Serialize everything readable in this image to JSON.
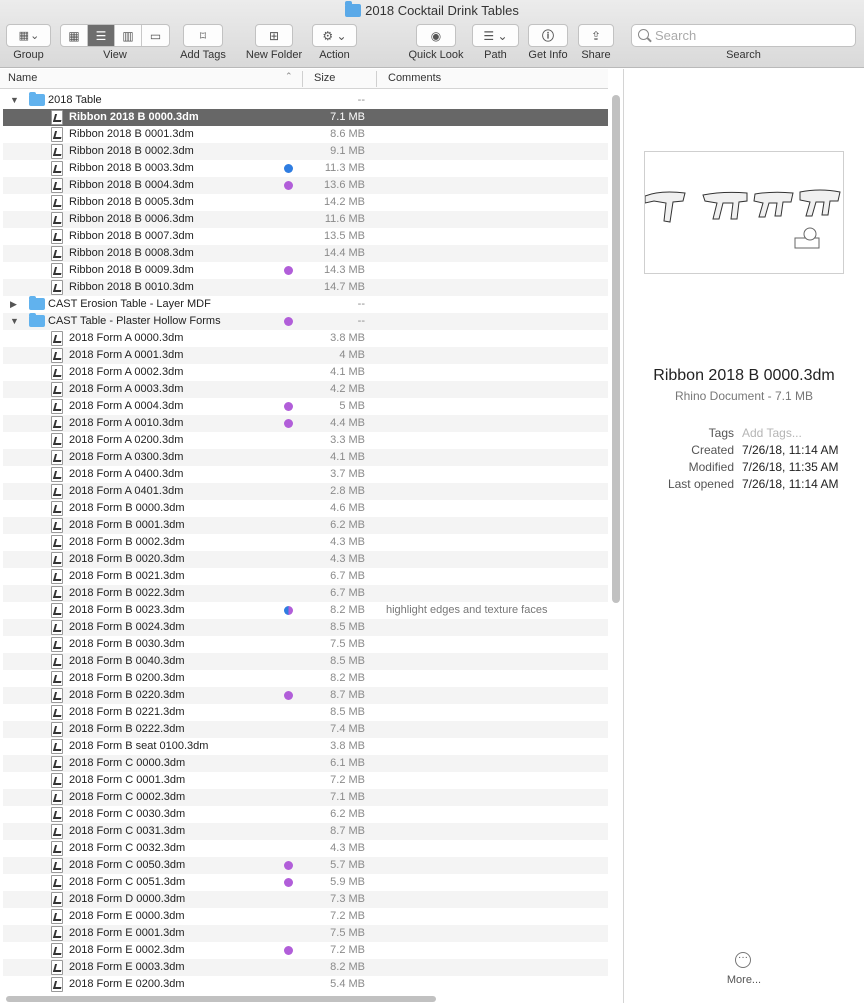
{
  "window": {
    "title": "2018 Cocktail Drink Tables"
  },
  "toolbar": {
    "group_label": "Group",
    "view_label": "View",
    "add_tags_label": "Add Tags",
    "new_folder_label": "New Folder",
    "action_label": "Action",
    "quick_look_label": "Quick Look",
    "path_label": "Path",
    "get_info_label": "Get Info",
    "share_label": "Share",
    "search_label": "Search",
    "search_placeholder": "Search"
  },
  "columns": {
    "name": "Name",
    "size": "Size",
    "comments": "Comments"
  },
  "rows": [
    {
      "type": "folder",
      "level": 0,
      "expanded": true,
      "name": "2018 Table",
      "size": "--"
    },
    {
      "type": "file",
      "level": 1,
      "name": "Ribbon 2018 B 0000.3dm",
      "size": "7.1 MB",
      "selected": true
    },
    {
      "type": "file",
      "level": 1,
      "name": "Ribbon 2018 B 0001.3dm",
      "size": "8.6 MB"
    },
    {
      "type": "file",
      "level": 1,
      "name": "Ribbon 2018 B 0002.3dm",
      "size": "9.1 MB"
    },
    {
      "type": "file",
      "level": 1,
      "name": "Ribbon 2018 B 0003.3dm",
      "size": "11.3 MB",
      "tag": "blue"
    },
    {
      "type": "file",
      "level": 1,
      "name": "Ribbon 2018 B 0004.3dm",
      "size": "13.6 MB",
      "tag": "purple"
    },
    {
      "type": "file",
      "level": 1,
      "name": "Ribbon 2018 B 0005.3dm",
      "size": "14.2 MB"
    },
    {
      "type": "file",
      "level": 1,
      "name": "Ribbon 2018 B 0006.3dm",
      "size": "11.6 MB"
    },
    {
      "type": "file",
      "level": 1,
      "name": "Ribbon 2018 B 0007.3dm",
      "size": "13.5 MB"
    },
    {
      "type": "file",
      "level": 1,
      "name": "Ribbon 2018 B 0008.3dm",
      "size": "14.4 MB"
    },
    {
      "type": "file",
      "level": 1,
      "name": "Ribbon 2018 B 0009.3dm",
      "size": "14.3 MB",
      "tag": "purple"
    },
    {
      "type": "file",
      "level": 1,
      "name": "Ribbon 2018 B 0010.3dm",
      "size": "14.7 MB"
    },
    {
      "type": "folder",
      "level": 0,
      "expanded": false,
      "name": "CAST Erosion Table - Layer MDF",
      "size": "--"
    },
    {
      "type": "folder",
      "level": 0,
      "expanded": true,
      "name": "CAST Table - Plaster Hollow Forms",
      "size": "--",
      "tag": "purple"
    },
    {
      "type": "file",
      "level": 1,
      "name": "2018 Form A 0000.3dm",
      "size": "3.8 MB"
    },
    {
      "type": "file",
      "level": 1,
      "name": "2018 Form A 0001.3dm",
      "size": "4 MB"
    },
    {
      "type": "file",
      "level": 1,
      "name": "2018 Form A 0002.3dm",
      "size": "4.1 MB"
    },
    {
      "type": "file",
      "level": 1,
      "name": "2018 Form A 0003.3dm",
      "size": "4.2 MB"
    },
    {
      "type": "file",
      "level": 1,
      "name": "2018 Form A 0004.3dm",
      "size": "5 MB",
      "tag": "purple"
    },
    {
      "type": "file",
      "level": 1,
      "name": "2018 Form A 0010.3dm",
      "size": "4.4 MB",
      "tag": "purple"
    },
    {
      "type": "file",
      "level": 1,
      "name": "2018 Form A 0200.3dm",
      "size": "3.3 MB"
    },
    {
      "type": "file",
      "level": 1,
      "name": "2018 Form A 0300.3dm",
      "size": "4.1 MB"
    },
    {
      "type": "file",
      "level": 1,
      "name": "2018 Form A 0400.3dm",
      "size": "3.7 MB"
    },
    {
      "type": "file",
      "level": 1,
      "name": "2018 Form A 0401.3dm",
      "size": "2.8 MB"
    },
    {
      "type": "file",
      "level": 1,
      "name": "2018 Form B 0000.3dm",
      "size": "4.6 MB"
    },
    {
      "type": "file",
      "level": 1,
      "name": "2018 Form B 0001.3dm",
      "size": "6.2 MB"
    },
    {
      "type": "file",
      "level": 1,
      "name": "2018 Form B 0002.3dm",
      "size": "4.3 MB"
    },
    {
      "type": "file",
      "level": 1,
      "name": "2018 Form B 0020.3dm",
      "size": "4.3 MB"
    },
    {
      "type": "file",
      "level": 1,
      "name": "2018 Form B 0021.3dm",
      "size": "6.7 MB"
    },
    {
      "type": "file",
      "level": 1,
      "name": "2018 Form B 0022.3dm",
      "size": "6.7 MB"
    },
    {
      "type": "file",
      "level": 1,
      "name": "2018 Form B 0023.3dm",
      "size": "8.2 MB",
      "tag": "dual",
      "comment": "highlight edges and texture faces"
    },
    {
      "type": "file",
      "level": 1,
      "name": "2018 Form B 0024.3dm",
      "size": "8.5 MB"
    },
    {
      "type": "file",
      "level": 1,
      "name": "2018 Form B 0030.3dm",
      "size": "7.5 MB"
    },
    {
      "type": "file",
      "level": 1,
      "name": "2018 Form B 0040.3dm",
      "size": "8.5 MB"
    },
    {
      "type": "file",
      "level": 1,
      "name": "2018 Form B 0200.3dm",
      "size": "8.2 MB"
    },
    {
      "type": "file",
      "level": 1,
      "name": "2018 Form B 0220.3dm",
      "size": "8.7 MB",
      "tag": "purple"
    },
    {
      "type": "file",
      "level": 1,
      "name": "2018 Form B 0221.3dm",
      "size": "8.5 MB"
    },
    {
      "type": "file",
      "level": 1,
      "name": "2018 Form B 0222.3dm",
      "size": "7.4 MB"
    },
    {
      "type": "file",
      "level": 1,
      "name": "2018 Form B seat 0100.3dm",
      "size": "3.8 MB"
    },
    {
      "type": "file",
      "level": 1,
      "name": "2018 Form C 0000.3dm",
      "size": "6.1 MB"
    },
    {
      "type": "file",
      "level": 1,
      "name": "2018 Form C 0001.3dm",
      "size": "7.2 MB"
    },
    {
      "type": "file",
      "level": 1,
      "name": "2018 Form C 0002.3dm",
      "size": "7.1 MB"
    },
    {
      "type": "file",
      "level": 1,
      "name": "2018 Form C 0030.3dm",
      "size": "6.2 MB"
    },
    {
      "type": "file",
      "level": 1,
      "name": "2018 Form C 0031.3dm",
      "size": "8.7 MB"
    },
    {
      "type": "file",
      "level": 1,
      "name": "2018 Form C 0032.3dm",
      "size": "4.3 MB"
    },
    {
      "type": "file",
      "level": 1,
      "name": "2018 Form C 0050.3dm",
      "size": "5.7 MB",
      "tag": "purple"
    },
    {
      "type": "file",
      "level": 1,
      "name": "2018 Form C 0051.3dm",
      "size": "5.9 MB",
      "tag": "purple"
    },
    {
      "type": "file",
      "level": 1,
      "name": "2018 Form D 0000.3dm",
      "size": "7.3 MB"
    },
    {
      "type": "file",
      "level": 1,
      "name": "2018 Form E 0000.3dm",
      "size": "7.2 MB"
    },
    {
      "type": "file",
      "level": 1,
      "name": "2018 Form E 0001.3dm",
      "size": "7.5 MB"
    },
    {
      "type": "file",
      "level": 1,
      "name": "2018 Form E 0002.3dm",
      "size": "7.2 MB",
      "tag": "purple"
    },
    {
      "type": "file",
      "level": 1,
      "name": "2018 Form E 0003.3dm",
      "size": "8.2 MB"
    },
    {
      "type": "file",
      "level": 1,
      "name": "2018 Form E 0200.3dm",
      "size": "5.4 MB"
    }
  ],
  "preview": {
    "name": "Ribbon 2018 B 0000.3dm",
    "kind": "Rhino Document - 7.1 MB",
    "tags_key": "Tags",
    "tags_placeholder": "Add Tags...",
    "created_key": "Created",
    "created": "7/26/18, 11:14 AM",
    "modified_key": "Modified",
    "modified": "7/26/18, 11:35 AM",
    "last_opened_key": "Last opened",
    "last_opened": "7/26/18, 11:14 AM",
    "more_label": "More..."
  },
  "colors": {
    "selection": "#676767",
    "tag_purple": "#b15ed9",
    "tag_blue": "#2f7de1",
    "folder": "#61b2ee"
  }
}
